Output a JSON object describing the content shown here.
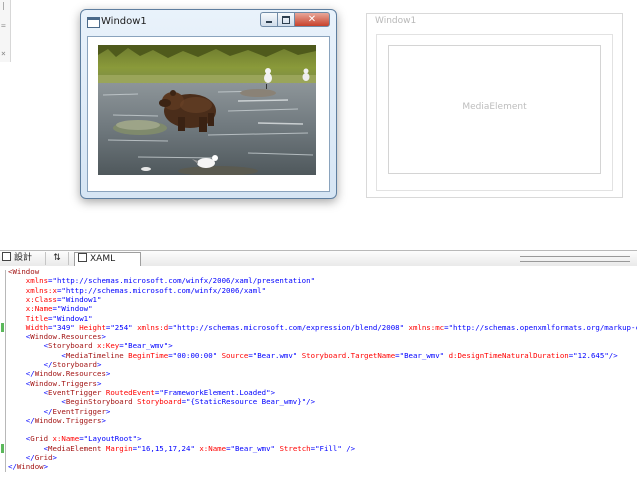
{
  "designer": {
    "running_window": {
      "title": "Window1",
      "controls": [
        "minimize",
        "maximize",
        "close"
      ],
      "content_icon": "video-frame"
    },
    "design_window": {
      "title": "Window1",
      "media_label": "MediaElement"
    }
  },
  "tabs": {
    "design": "設計",
    "swap": "⇅",
    "xaml": "XAML"
  },
  "xaml_lines": [
    [
      [
        "tag",
        "<Window"
      ]
    ],
    [
      [
        "attr",
        "    xmlns"
      ],
      [
        "punc",
        "="
      ],
      [
        "val",
        "\"http://schemas.microsoft.com/winfx/2006/xaml/presentation\""
      ]
    ],
    [
      [
        "attr",
        "    xmlns:x"
      ],
      [
        "punc",
        "="
      ],
      [
        "val",
        "\"http://schemas.microsoft.com/winfx/2006/xaml\""
      ]
    ],
    [
      [
        "attr",
        "    x:Class"
      ],
      [
        "punc",
        "="
      ],
      [
        "val",
        "\"Window1\""
      ]
    ],
    [
      [
        "attr",
        "    x:Name"
      ],
      [
        "punc",
        "="
      ],
      [
        "val",
        "\"Window\""
      ]
    ],
    [
      [
        "attr",
        "    Title"
      ],
      [
        "punc",
        "="
      ],
      [
        "val",
        "\"Window1\""
      ]
    ],
    [
      [
        "attr",
        "    Width"
      ],
      [
        "punc",
        "="
      ],
      [
        "val",
        "\"349\" "
      ],
      [
        "attr",
        "Height"
      ],
      [
        "punc",
        "="
      ],
      [
        "val",
        "\"254\" "
      ],
      [
        "attr",
        "xmlns:d"
      ],
      [
        "punc",
        "="
      ],
      [
        "val",
        "\"http://schemas.microsoft.com/expression/blend/2008\" "
      ],
      [
        "attr",
        "xmlns:mc"
      ],
      [
        "punc",
        "="
      ],
      [
        "val",
        "\"http://schemas.openxmlformats.org/markup-com"
      ]
    ],
    [
      [
        "punc",
        "    <"
      ],
      [
        "tag",
        "Window.Resources"
      ],
      [
        "punc",
        ">"
      ]
    ],
    [
      [
        "punc",
        "        <"
      ],
      [
        "tag",
        "Storyboard "
      ],
      [
        "attr",
        "x:Key"
      ],
      [
        "punc",
        "="
      ],
      [
        "val",
        "\"Bear_wmv\""
      ],
      [
        "punc",
        ">"
      ]
    ],
    [
      [
        "punc",
        "            <"
      ],
      [
        "tag",
        "MediaTimeline "
      ],
      [
        "attr",
        "BeginTime"
      ],
      [
        "punc",
        "="
      ],
      [
        "val",
        "\"00:00:00\" "
      ],
      [
        "attr",
        "Source"
      ],
      [
        "punc",
        "="
      ],
      [
        "val",
        "\"Bear.wmv\" "
      ],
      [
        "attr",
        "Storyboard.TargetName"
      ],
      [
        "punc",
        "="
      ],
      [
        "val",
        "\"Bear_wmv\" "
      ],
      [
        "attr",
        "d:DesignTimeNaturalDuration"
      ],
      [
        "punc",
        "="
      ],
      [
        "val",
        "\"12.645\""
      ],
      [
        "punc",
        "/>"
      ]
    ],
    [
      [
        "punc",
        "        </"
      ],
      [
        "tag",
        "Storyboard"
      ],
      [
        "punc",
        ">"
      ]
    ],
    [
      [
        "punc",
        "    </"
      ],
      [
        "tag",
        "Window.Resources"
      ],
      [
        "punc",
        ">"
      ]
    ],
    [
      [
        "punc",
        "    <"
      ],
      [
        "tag",
        "Window.Triggers"
      ],
      [
        "punc",
        ">"
      ]
    ],
    [
      [
        "punc",
        "        <"
      ],
      [
        "tag",
        "EventTrigger "
      ],
      [
        "attr",
        "RoutedEvent"
      ],
      [
        "punc",
        "="
      ],
      [
        "val",
        "\"FrameworkElement.Loaded\""
      ],
      [
        "punc",
        ">"
      ]
    ],
    [
      [
        "punc",
        "            <"
      ],
      [
        "tag",
        "BeginStoryboard "
      ],
      [
        "attr",
        "Storyboard"
      ],
      [
        "punc",
        "="
      ],
      [
        "val",
        "\"{StaticResource Bear_wmv}\""
      ],
      [
        "punc",
        "/>"
      ]
    ],
    [
      [
        "punc",
        "        </"
      ],
      [
        "tag",
        "EventTrigger"
      ],
      [
        "punc",
        ">"
      ]
    ],
    [
      [
        "punc",
        "    </"
      ],
      [
        "tag",
        "Window.Triggers"
      ],
      [
        "punc",
        ">"
      ]
    ],
    [
      [
        "punc",
        ""
      ]
    ],
    [
      [
        "punc",
        "    <"
      ],
      [
        "tag",
        "Grid "
      ],
      [
        "attr",
        "x:Name"
      ],
      [
        "punc",
        "="
      ],
      [
        "val",
        "\"LayoutRoot\""
      ],
      [
        "punc",
        ">"
      ]
    ],
    [
      [
        "punc",
        "        <"
      ],
      [
        "tag",
        "MediaElement "
      ],
      [
        "attr",
        "Margin"
      ],
      [
        "punc",
        "="
      ],
      [
        "val",
        "\"16,15,17,24\" "
      ],
      [
        "attr",
        "x:Name"
      ],
      [
        "punc",
        "="
      ],
      [
        "val",
        "\"Bear_wmv\" "
      ],
      [
        "attr",
        "Stretch"
      ],
      [
        "punc",
        "="
      ],
      [
        "val",
        "\"Fill\" "
      ],
      [
        "punc",
        "/>"
      ]
    ],
    [
      [
        "punc",
        "    </"
      ],
      [
        "tag",
        "Grid"
      ],
      [
        "punc",
        ">"
      ]
    ],
    [
      [
        "punc",
        "</"
      ],
      [
        "tag",
        "Window"
      ],
      [
        "punc",
        ">"
      ]
    ]
  ],
  "changed_lines": [
    6,
    19
  ]
}
